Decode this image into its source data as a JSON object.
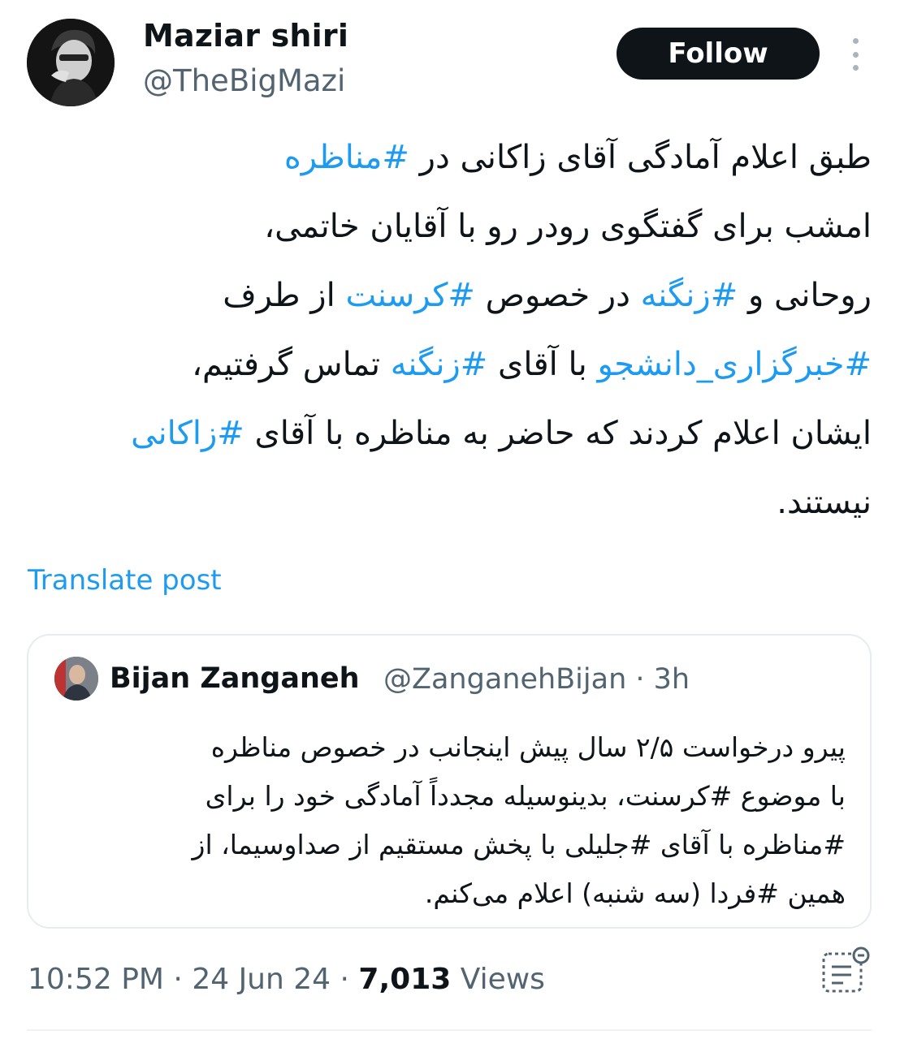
{
  "author": {
    "name": "Maziar shiri",
    "handle": "@TheBigMazi",
    "follow_label": "Follow"
  },
  "post": {
    "lines": [
      [
        {
          "t": "طبق اعلام  آمادگی آقای زاکانی در "
        },
        {
          "t": "#مناظره",
          "tag": true
        }
      ],
      [
        {
          "t": "امشب برای گفتگوی رودر رو با آقایان خاتمی،"
        }
      ],
      [
        {
          "t": "روحانی و  "
        },
        {
          "t": "#زنگنه",
          "tag": true
        },
        {
          "t": " در خصوص "
        },
        {
          "t": "#کرسنت",
          "tag": true
        },
        {
          "t": " از طرف"
        }
      ],
      [
        {
          "t": "#خبرگزاری_دانشجو",
          "tag": true
        },
        {
          "t": " با آقای "
        },
        {
          "t": "#زنگنه",
          "tag": true
        },
        {
          "t": "  تماس گرفتیم،"
        }
      ],
      [
        {
          "t": "ایشان اعلام کردند که حاضر به مناظره با آقای "
        },
        {
          "t": "#زاکانی",
          "tag": true
        }
      ],
      [
        {
          "t": "نیستند."
        }
      ]
    ],
    "translate_label": "Translate post"
  },
  "quote": {
    "name": "Bijan Zanganeh",
    "handle_time": "@ZanganehBijan · 3h",
    "lines": [
      "پیرو درخواست ۲/۵ سال پیش اینجانب در خصوص مناظره",
      "با موضوع #کرسنت، بدینوسیله مجدداً آمادگی خود را برای",
      "#مناظره با آقای #جلیلی با پخش مستقیم از صداوسیما، از",
      "همین #فردا (سه شنبه) اعلام می‌کنم."
    ]
  },
  "meta": {
    "time": "10:52 PM",
    "sep1": " · ",
    "date": "24 Jun 24",
    "sep2": " · ",
    "views_count": "7,013",
    "views_label": " Views"
  },
  "icons": {
    "more": "more-vertical-icon",
    "analytics": "analytics-icon"
  },
  "colors": {
    "accent": "#1d9bf0",
    "text": "#0f1419",
    "secondary": "#536471"
  }
}
